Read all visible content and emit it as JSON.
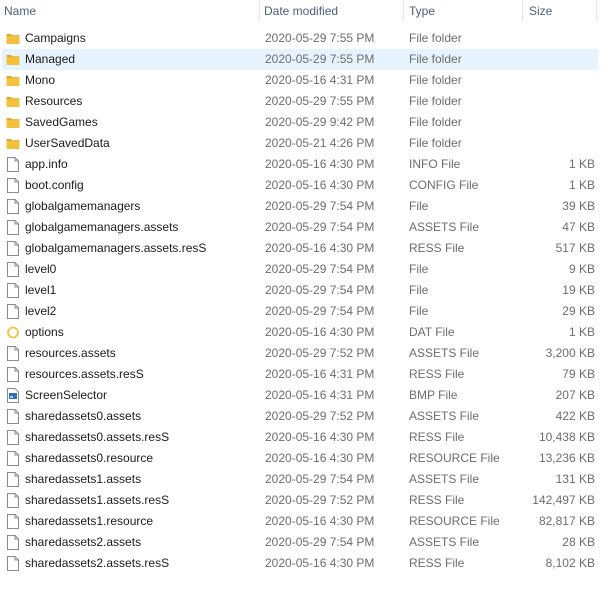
{
  "columns": {
    "name": "Name",
    "date": "Date modified",
    "type": "Type",
    "size": "Size"
  },
  "colors": {
    "folder": "#f3c23d",
    "folder_dark": "#e0a82a",
    "selected_row": "#e5f3ff",
    "header_text": "#4c607a"
  },
  "files": [
    {
      "name": "Campaigns",
      "date": "2020-05-29 7:55 PM",
      "type": "File folder",
      "size": "",
      "icon": "folder-icon"
    },
    {
      "name": "Managed",
      "date": "2020-05-29 7:55 PM",
      "type": "File folder",
      "size": "",
      "icon": "folder-icon",
      "selected": true
    },
    {
      "name": "Mono",
      "date": "2020-05-16 4:31 PM",
      "type": "File folder",
      "size": "",
      "icon": "folder-icon"
    },
    {
      "name": "Resources",
      "date": "2020-05-29 7:55 PM",
      "type": "File folder",
      "size": "",
      "icon": "folder-icon"
    },
    {
      "name": "SavedGames",
      "date": "2020-05-29 9:42 PM",
      "type": "File folder",
      "size": "",
      "icon": "folder-icon"
    },
    {
      "name": "UserSavedData",
      "date": "2020-05-21 4:26 PM",
      "type": "File folder",
      "size": "",
      "icon": "folder-icon"
    },
    {
      "name": "app.info",
      "date": "2020-05-16 4:30 PM",
      "type": "INFO File",
      "size": "1 KB",
      "icon": "file-icon"
    },
    {
      "name": "boot.config",
      "date": "2020-05-16 4:30 PM",
      "type": "CONFIG File",
      "size": "1 KB",
      "icon": "file-icon"
    },
    {
      "name": "globalgamemanagers",
      "date": "2020-05-29 7:54 PM",
      "type": "File",
      "size": "39 KB",
      "icon": "file-icon"
    },
    {
      "name": "globalgamemanagers.assets",
      "date": "2020-05-29 7:54 PM",
      "type": "ASSETS File",
      "size": "47 KB",
      "icon": "file-icon"
    },
    {
      "name": "globalgamemanagers.assets.resS",
      "date": "2020-05-16 4:30 PM",
      "type": "RESS File",
      "size": "517 KB",
      "icon": "file-icon"
    },
    {
      "name": "level0",
      "date": "2020-05-29 7:54 PM",
      "type": "File",
      "size": "9 KB",
      "icon": "file-icon"
    },
    {
      "name": "level1",
      "date": "2020-05-29 7:54 PM",
      "type": "File",
      "size": "19 KB",
      "icon": "file-icon"
    },
    {
      "name": "level2",
      "date": "2020-05-29 7:54 PM",
      "type": "File",
      "size": "29 KB",
      "icon": "file-icon"
    },
    {
      "name": "options",
      "date": "2020-05-16 4:30 PM",
      "type": "DAT File",
      "size": "1 KB",
      "icon": "dat-file-icon"
    },
    {
      "name": "resources.assets",
      "date": "2020-05-29 7:52 PM",
      "type": "ASSETS File",
      "size": "3,200 KB",
      "icon": "file-icon"
    },
    {
      "name": "resources.assets.resS",
      "date": "2020-05-16 4:31 PM",
      "type": "RESS File",
      "size": "79 KB",
      "icon": "file-icon"
    },
    {
      "name": "ScreenSelector",
      "date": "2020-05-16 4:31 PM",
      "type": "BMP File",
      "size": "207 KB",
      "icon": "bmp-file-icon"
    },
    {
      "name": "sharedassets0.assets",
      "date": "2020-05-29 7:52 PM",
      "type": "ASSETS File",
      "size": "422 KB",
      "icon": "file-icon"
    },
    {
      "name": "sharedassets0.assets.resS",
      "date": "2020-05-16 4:30 PM",
      "type": "RESS File",
      "size": "10,438 KB",
      "icon": "file-icon"
    },
    {
      "name": "sharedassets0.resource",
      "date": "2020-05-16 4:30 PM",
      "type": "RESOURCE File",
      "size": "13,236 KB",
      "icon": "file-icon"
    },
    {
      "name": "sharedassets1.assets",
      "date": "2020-05-29 7:54 PM",
      "type": "ASSETS File",
      "size": "131 KB",
      "icon": "file-icon"
    },
    {
      "name": "sharedassets1.assets.resS",
      "date": "2020-05-29 7:52 PM",
      "type": "RESS File",
      "size": "142,497 KB",
      "icon": "file-icon"
    },
    {
      "name": "sharedassets1.resource",
      "date": "2020-05-16 4:30 PM",
      "type": "RESOURCE File",
      "size": "82,817 KB",
      "icon": "file-icon"
    },
    {
      "name": "sharedassets2.assets",
      "date": "2020-05-29 7:54 PM",
      "type": "ASSETS File",
      "size": "28 KB",
      "icon": "file-icon"
    },
    {
      "name": "sharedassets2.assets.resS",
      "date": "2020-05-16 4:30 PM",
      "type": "RESS File",
      "size": "8,102 KB",
      "icon": "file-icon"
    }
  ]
}
